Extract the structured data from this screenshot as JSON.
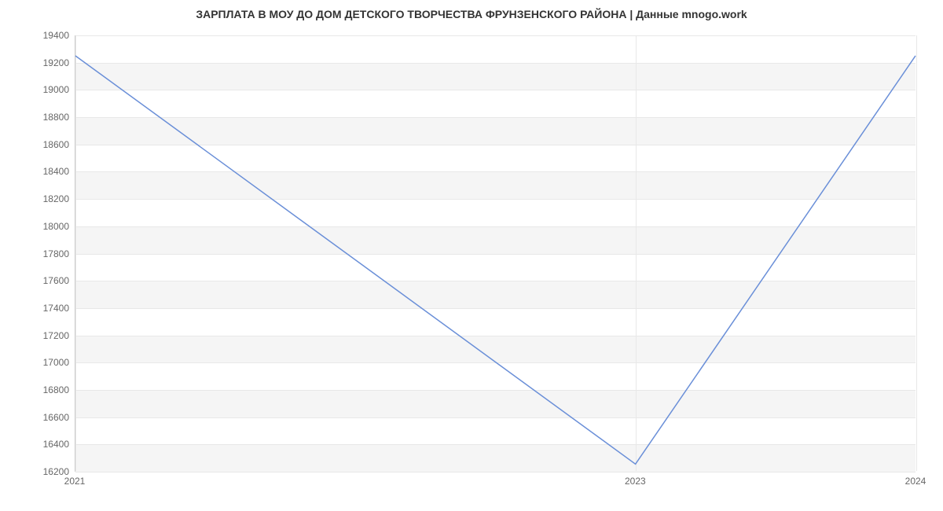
{
  "chart_data": {
    "type": "line",
    "title": "ЗАРПЛАТА В МОУ ДО ДОМ ДЕТСКОГО ТВОРЧЕСТВА ФРУНЗЕНСКОГО РАЙОНА | Данные mnogo.work",
    "xlabel": "",
    "ylabel": "",
    "x": [
      2021,
      2023,
      2024
    ],
    "values": [
      19250,
      16250,
      19250
    ],
    "ylim": [
      16200,
      19400
    ],
    "xlim": [
      2021,
      2024
    ],
    "y_ticks": [
      16200,
      16400,
      16600,
      16800,
      17000,
      17200,
      17400,
      17600,
      17800,
      18000,
      18200,
      18400,
      18600,
      18800,
      19000,
      19200,
      19400
    ],
    "x_ticks": [
      2021,
      2023,
      2024
    ],
    "line_color": "#6a8fd8"
  }
}
